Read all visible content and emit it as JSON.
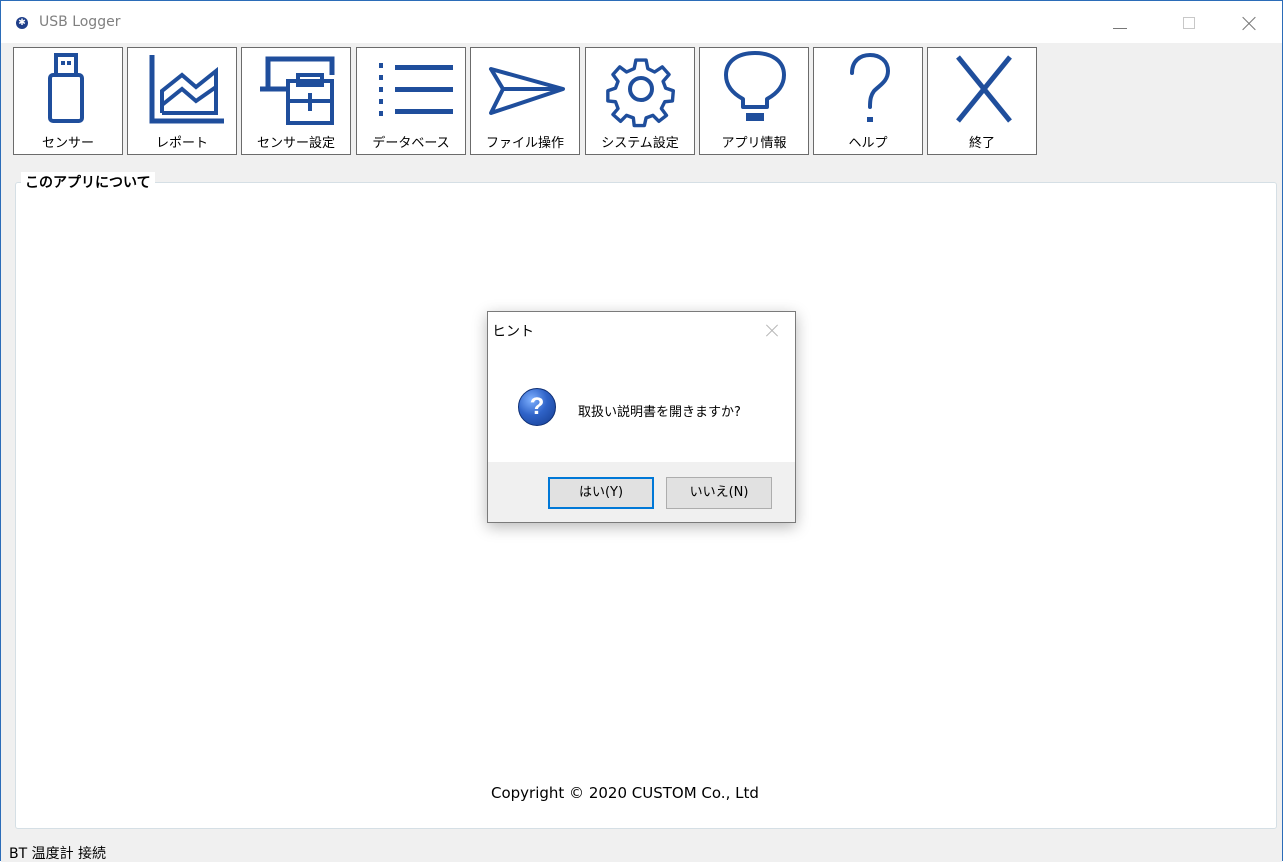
{
  "window": {
    "title": "USB Logger"
  },
  "toolbar": {
    "buttons": [
      {
        "label": "センサー",
        "icon": "usb-stick-icon"
      },
      {
        "label": "レポート",
        "icon": "chart-report-icon"
      },
      {
        "label": "センサー設定",
        "icon": "sensor-settings-icon"
      },
      {
        "label": "データベース",
        "icon": "list-icon"
      },
      {
        "label": "ファイル操作",
        "icon": "paper-plane-icon"
      },
      {
        "label": "システム設定",
        "icon": "gear-icon"
      },
      {
        "label": "アプリ情報",
        "icon": "lightbulb-icon"
      },
      {
        "label": "ヘルプ",
        "icon": "question-mark-icon"
      },
      {
        "label": "終了",
        "icon": "close-x-icon"
      }
    ],
    "icon_color": "#1f4e9c"
  },
  "main": {
    "group_title": "このアプリについて",
    "copyright": "Copyright © 2020 CUSTOM Co., Ltd"
  },
  "status": {
    "text": "BT 温度計 接続"
  },
  "dialog": {
    "title": "ヒント",
    "message": "取扱い説明書を開きますか?",
    "yes_label": "はい(Y)",
    "no_label": "いいえ(N)"
  }
}
